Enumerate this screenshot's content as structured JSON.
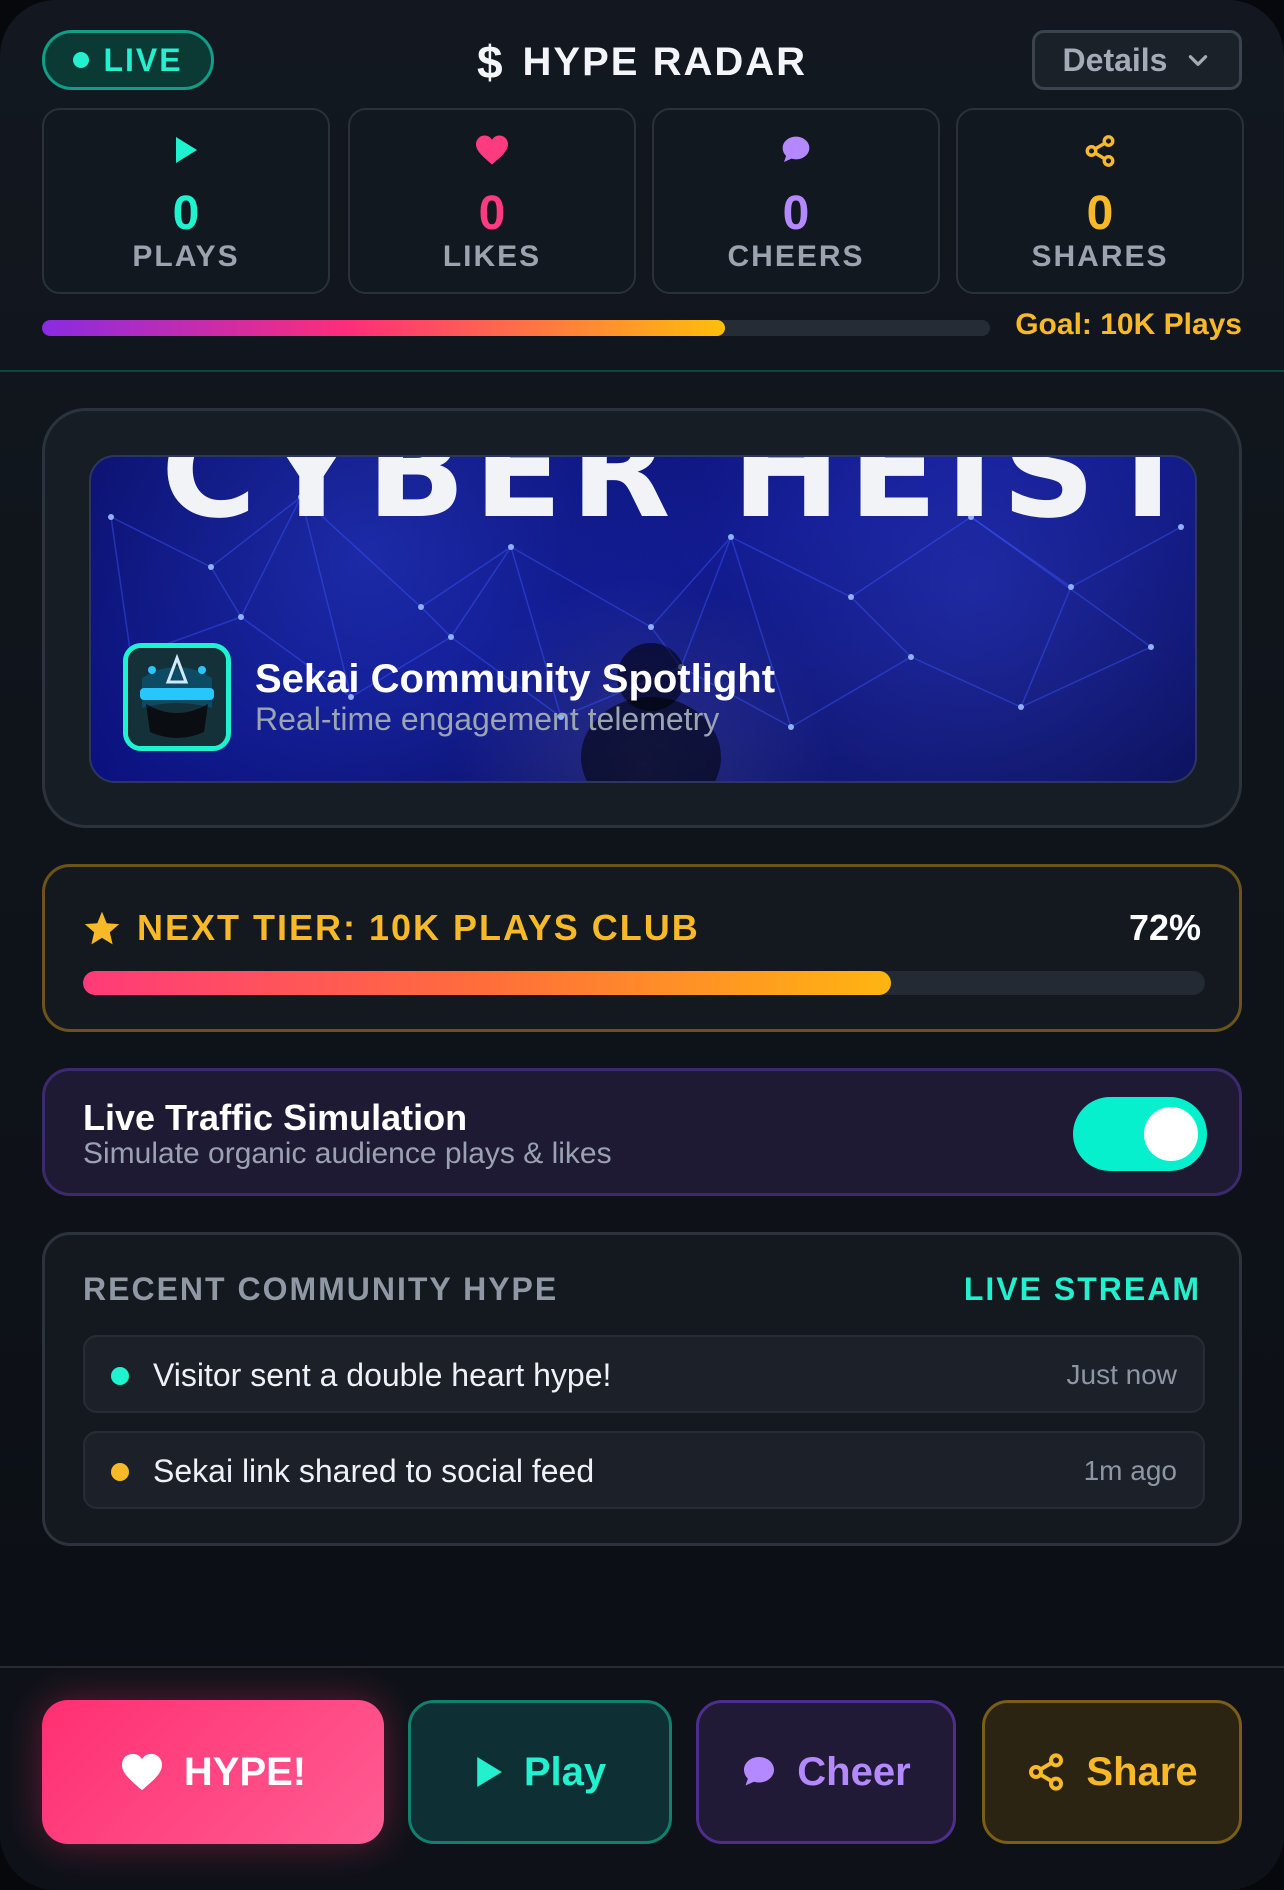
{
  "header": {
    "live_label": "LIVE",
    "title": "HYPE RADAR",
    "title_icon": "dollar-icon",
    "details_label": "Details"
  },
  "stats": [
    {
      "icon": "play-icon",
      "value": "0",
      "label": "PLAYS",
      "color": "#1ef2cf"
    },
    {
      "icon": "heart-icon",
      "value": "0",
      "label": "LIKES",
      "color": "#ff3b7f"
    },
    {
      "icon": "chat-bubble-icon",
      "value": "0",
      "label": "CHEERS",
      "color": "#b489ff"
    },
    {
      "icon": "share-icon",
      "value": "0",
      "label": "SHARES",
      "color": "#f7b928"
    }
  ],
  "goal": {
    "label": "Goal: 10K Plays",
    "progress": 0.72
  },
  "hero": {
    "banner_text": "CYBER HEIST",
    "spotlight_title": "Sekai Community Spotlight",
    "spotlight_subtitle": "Real-time engagement telemetry"
  },
  "tier": {
    "label": "NEXT TIER: 10K PLAYS CLUB",
    "percent_text": "72%",
    "progress": 0.72
  },
  "simulation": {
    "title": "Live Traffic Simulation",
    "subtitle": "Simulate organic audience plays & likes",
    "enabled": true
  },
  "feed": {
    "title": "RECENT COMMUNITY HYPE",
    "stream_label": "LIVE STREAM",
    "items": [
      {
        "text": "Visitor sent a double heart hype!",
        "time": "Just now",
        "dot_color": "#1ef2cf"
      },
      {
        "text": "Sekai link shared to social feed",
        "time": "1m ago",
        "dot_color": "#f7b928"
      }
    ]
  },
  "actions": {
    "hype_label": "HYPE!",
    "play_label": "Play",
    "cheer_label": "Cheer",
    "share_label": "Share"
  }
}
